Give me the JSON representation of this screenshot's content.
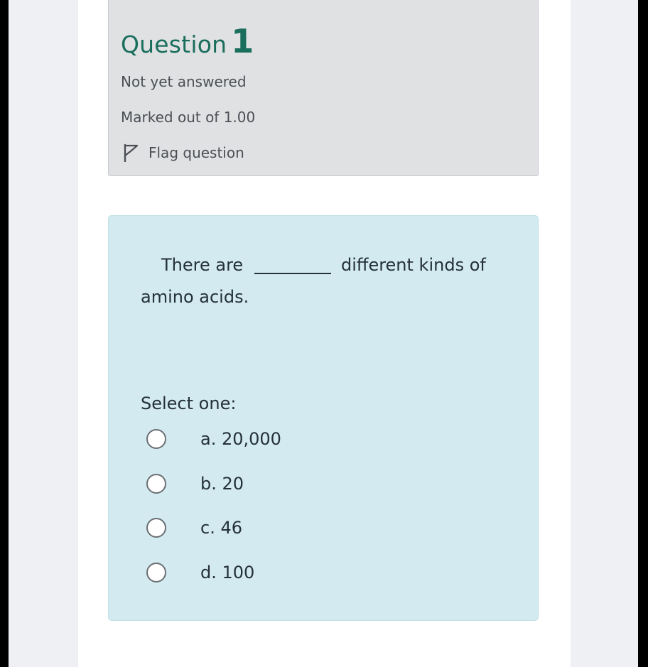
{
  "question": {
    "word": "Question",
    "number": "1",
    "status": "Not yet answered",
    "marks": "Marked out of 1.00",
    "flag_label": "Flag question"
  },
  "prompt": {
    "part1": "There are",
    "part2": "different kinds of",
    "part3": "amino acids."
  },
  "select_label": "Select one:",
  "options": [
    {
      "label": "a. 20,000",
      "selected": false
    },
    {
      "label": "b. 20",
      "selected": false
    },
    {
      "label": "c. 46",
      "selected": false
    },
    {
      "label": "d. 100",
      "selected": false
    }
  ],
  "colors": {
    "title": "#1a6e5c",
    "info_bg": "#e0e1e3",
    "question_bg": "#d3ebf0",
    "page_bg": "#eef0f4"
  },
  "icons": [
    "flag-icon",
    "radio-icon"
  ]
}
